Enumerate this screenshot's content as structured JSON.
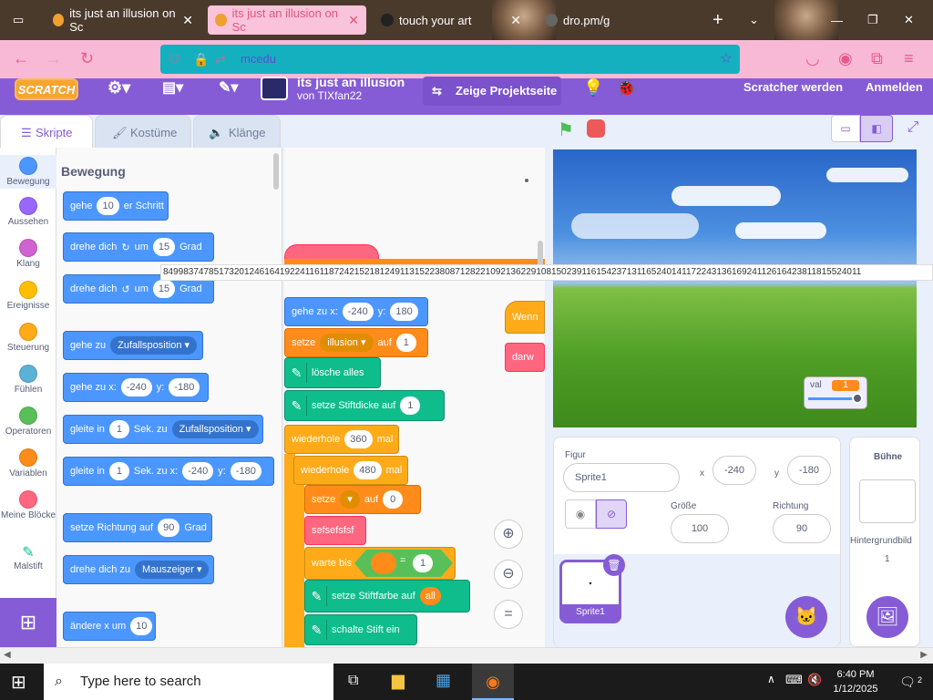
{
  "browser": {
    "tabs": [
      {
        "label": "its just an illusion on Sc",
        "active": false
      },
      {
        "label": "its just an illusion on Sc",
        "active": true
      },
      {
        "label": "touch your art",
        "active": false
      },
      {
        "label": "dro.pm/g",
        "active": false
      }
    ],
    "url_visible": "mcedu"
  },
  "menubar": {
    "logo": "SCRATCH",
    "project_title": "its just an illusion",
    "author": "von TIXfan22",
    "view_project": "Zeige Projektseite",
    "join": "Scratcher werden",
    "signin": "Anmelden"
  },
  "editor_tabs": {
    "code": "Skripte",
    "costumes": "Kostüme",
    "sounds": "Klänge"
  },
  "categories": [
    {
      "label": "Bewegung",
      "color": "#4c97ff"
    },
    {
      "label": "Aussehen",
      "color": "#9966ff"
    },
    {
      "label": "Klang",
      "color": "#cf63cf"
    },
    {
      "label": "Ereignisse",
      "color": "#ffbf00"
    },
    {
      "label": "Steuerung",
      "color": "#ffab19"
    },
    {
      "label": "Fühlen",
      "color": "#5cb1d6"
    },
    {
      "label": "Operatoren",
      "color": "#59c059"
    },
    {
      "label": "Variablen",
      "color": "#ff8c1a"
    },
    {
      "label": "Meine Blöcke",
      "color": "#ff6680"
    },
    {
      "label": "Malstift",
      "color": "#0fbd8c"
    }
  ],
  "palette": {
    "heading": "Bewegung",
    "move": {
      "a": "gehe",
      "v": "10",
      "b": "er Schritt"
    },
    "turn_cw": {
      "a": "drehe dich",
      "b": "um",
      "v": "15",
      "c": "Grad"
    },
    "turn_ccw": {
      "a": "drehe dich",
      "b": "um",
      "v": "15",
      "c": "Grad"
    },
    "goto": {
      "a": "gehe zu",
      "dd": "Zufallsposition"
    },
    "gotoxy": {
      "a": "gehe zu x:",
      "x": "-240",
      "b": "y:",
      "y": "-180"
    },
    "glide": {
      "a": "gleite in",
      "v": "1",
      "b": "Sek. zu",
      "dd": "Zufallsposition"
    },
    "glidexy": {
      "a": "gleite in",
      "v": "1",
      "b": "Sek. zu x:",
      "x": "-240",
      "c": "y:",
      "y": "-180"
    },
    "direction": {
      "a": "setze Richtung auf",
      "v": "90",
      "b": "Grad"
    },
    "pointto": {
      "a": "drehe dich zu",
      "dd": "Mauszeiger"
    },
    "changex": {
      "a": "ändere x um",
      "v": "10"
    }
  },
  "number_strip": "8499837478517320124616419224116118724215218124911315223808712822109213622910815023911615423713116524014117224313616924112616423811815524011",
  "script": {
    "gotoxy": {
      "a": "gehe zu x:",
      "x": "-240",
      "b": "y:",
      "y": "180"
    },
    "setvar": {
      "a": "setze",
      "dd": "illusion",
      "b": "auf",
      "v": "1"
    },
    "clear": "lösche alles",
    "pensize": {
      "a": "setze Stiftdicke auf",
      "v": "1"
    },
    "repeat1": {
      "a": "wiederhole",
      "v": "360",
      "b": "mal"
    },
    "repeat2": {
      "a": "wiederhole",
      "v": "480",
      "b": "mal"
    },
    "setvar2": {
      "a": "setze",
      "b": "auf",
      "v": "0"
    },
    "custom": "sefsefsfsf",
    "waituntil": {
      "a": "warte bis",
      "eq": "=",
      "v": "1"
    },
    "pencolor": {
      "a": "setze Stiftfarbe auf",
      "v": "all"
    },
    "pendown": "schalte Stift ein",
    "when_label": "Wenn",
    "draw_label": "darw"
  },
  "stage_monitor": {
    "name": "val",
    "value": "1"
  },
  "sprite_info": {
    "figure_label": "Figur",
    "figure_name": "Sprite1",
    "x_label": "x",
    "x": "-240",
    "y_label": "y",
    "y": "-180",
    "size_label": "Größe",
    "size": "100",
    "direction_label": "Richtung",
    "direction": "90",
    "sprite_thumb": "Sprite1"
  },
  "stage_info": {
    "label": "Bühne",
    "backdrops_label": "Hintergrundbild",
    "backdrops": "1"
  },
  "taskbar": {
    "search": "Type here to search",
    "time": "6:40 PM",
    "date": "1/12/2025",
    "notif": "2"
  }
}
